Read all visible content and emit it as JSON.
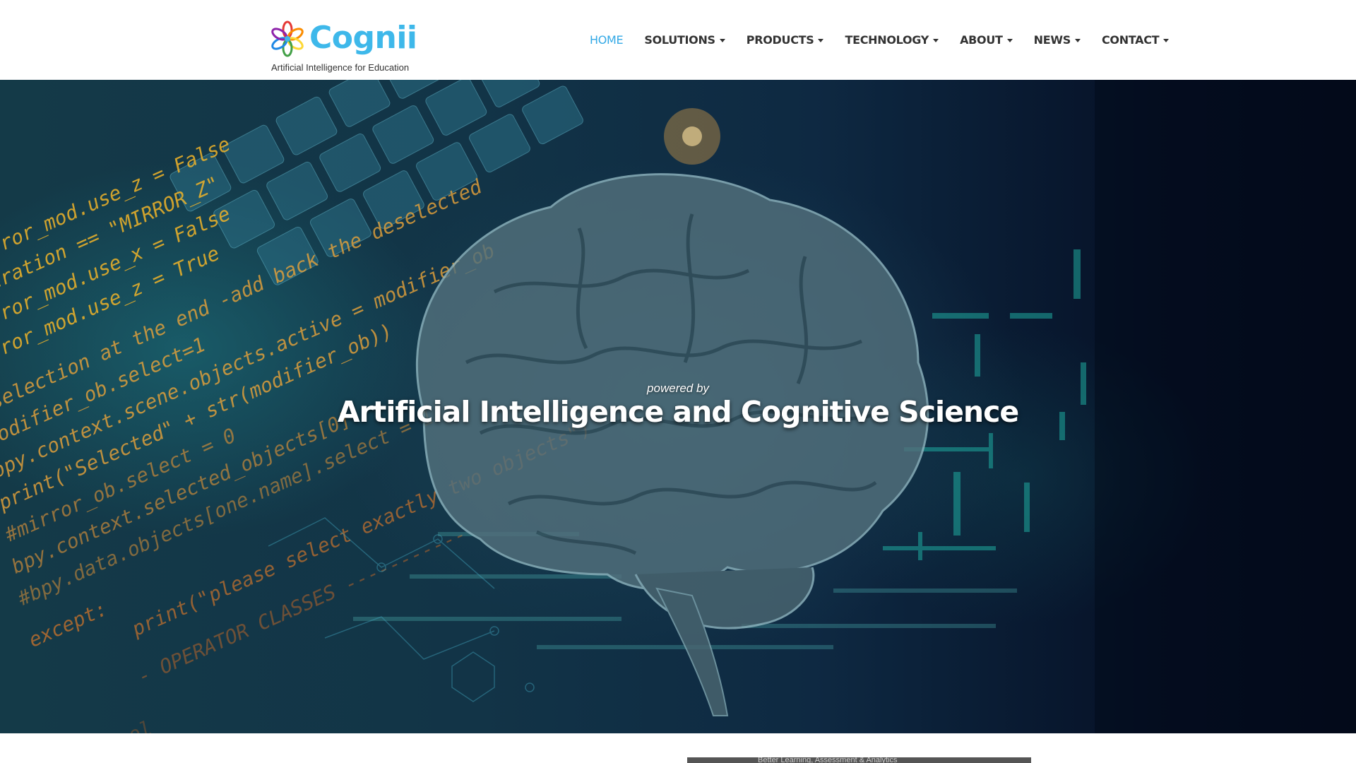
{
  "brand": {
    "name": "Cognii",
    "tagline": "Artificial Intelligence for Education",
    "accent_color": "#3eb8ea",
    "petal_colors": [
      "#e53935",
      "#fb8c00",
      "#fdd835",
      "#43a047",
      "#1e88e5",
      "#8e24aa"
    ]
  },
  "nav": {
    "items": [
      {
        "label": "HOME",
        "active": true,
        "dropdown": false
      },
      {
        "label": "SOLUTIONS",
        "active": false,
        "dropdown": true
      },
      {
        "label": "PRODUCTS",
        "active": false,
        "dropdown": true
      },
      {
        "label": "TECHNOLOGY",
        "active": false,
        "dropdown": true
      },
      {
        "label": "ABOUT",
        "active": false,
        "dropdown": true
      },
      {
        "label": "NEWS",
        "active": false,
        "dropdown": true
      },
      {
        "label": "CONTACT",
        "active": false,
        "dropdown": true
      }
    ],
    "active_color": "#33a9e6",
    "text_color": "#333333"
  },
  "hero": {
    "kicker": "powered by",
    "headline": "Artificial Intelligence and Cognitive Science",
    "background_image": "brain-over-code-keyboard"
  },
  "below_fold": {
    "preview_caption": "Better Learning, Assessment & Analytics"
  }
}
